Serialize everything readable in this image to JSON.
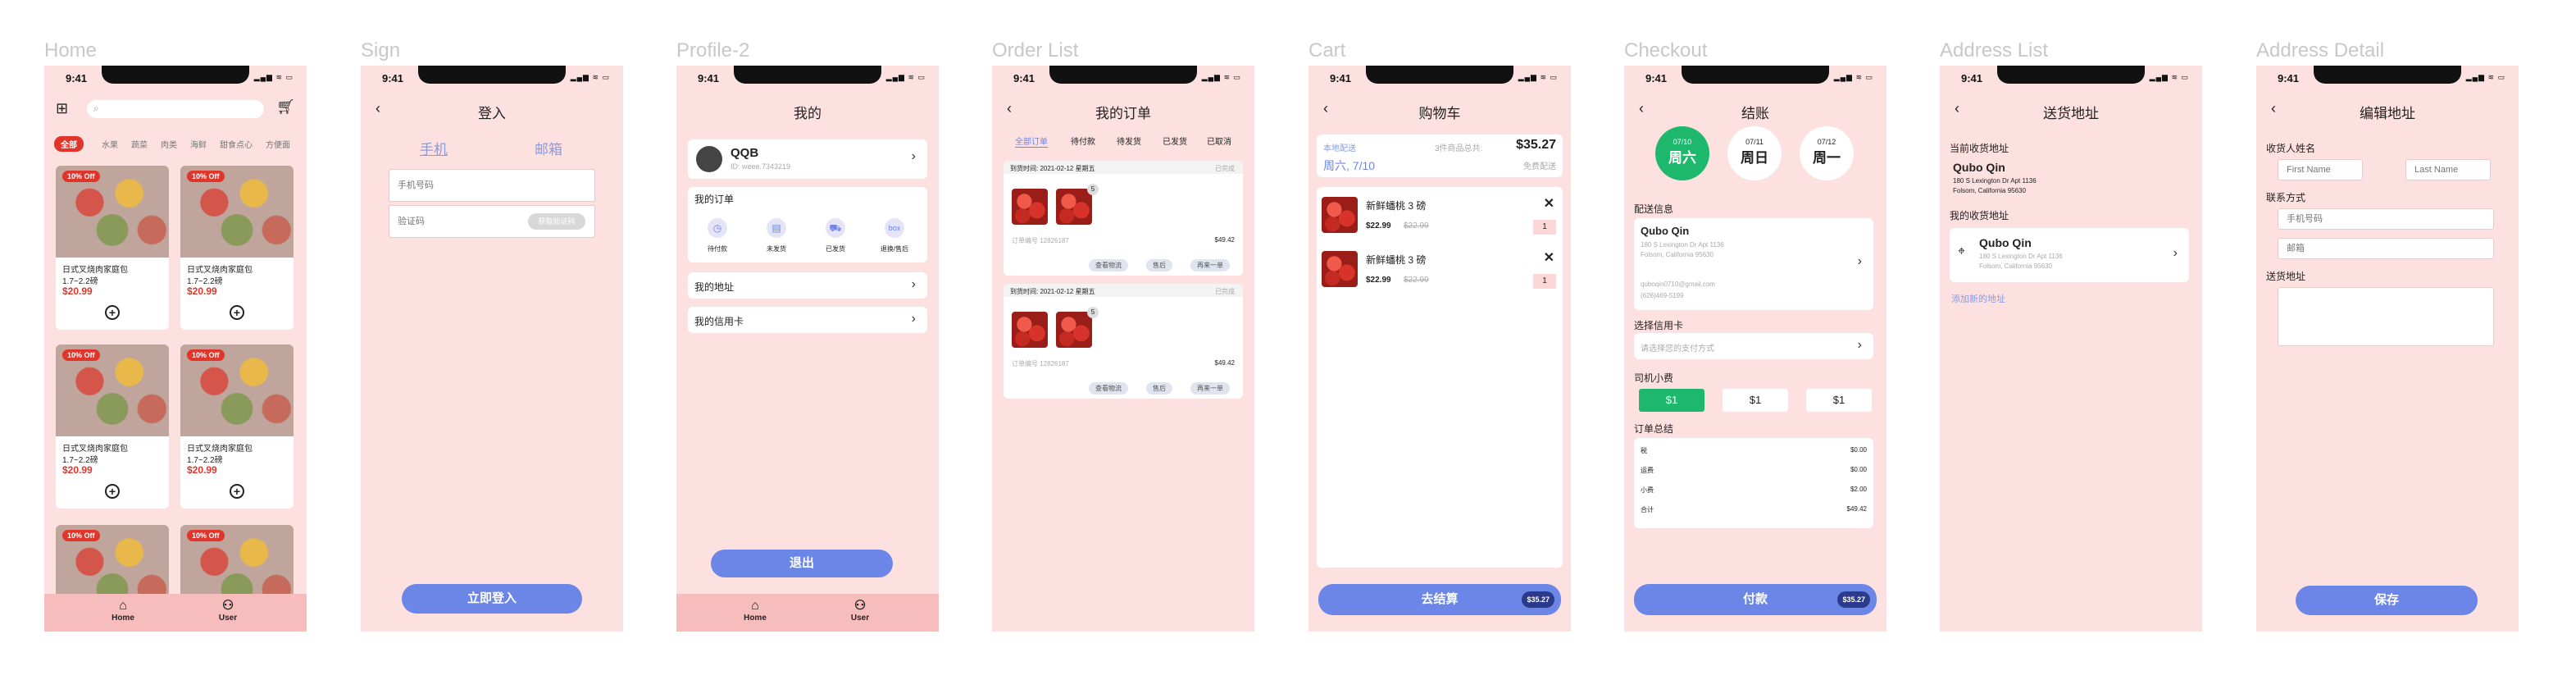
{
  "frames": {
    "home": "Home",
    "sign": "Sign",
    "profile": "Profile-2",
    "orders": "Order List",
    "cart": "Cart",
    "checkout": "Checkout",
    "address_list": "Address List",
    "address_detail": "Address Detail"
  },
  "status": {
    "time": "9:41",
    "icons": "▂▄▆ ≋ ▭"
  },
  "colors": {
    "background": "#fde0e0",
    "accent": "#6b86e6",
    "price": "#e0352b",
    "green": "#1db86b",
    "bottom_bar": "#f7bcbc"
  },
  "home": {
    "categories": [
      "全部",
      "水果",
      "蔬菜",
      "肉类",
      "海鲜",
      "甜食点心",
      "方便面"
    ],
    "discount": "10% Off",
    "product_name": "日式叉烧肉家庭包",
    "product_weight": "1.7~2.2磅",
    "product_price": "$20.99",
    "tab_home": "Home",
    "tab_user": "User"
  },
  "sign": {
    "title": "登入",
    "tab_phone": "手机",
    "tab_email": "邮箱",
    "phone_placeholder": "手机号码",
    "code_placeholder": "验证码",
    "send_code": "获取验证码",
    "login": "立即登入"
  },
  "profile": {
    "title": "我的",
    "user_name": "QQB",
    "user_id": "ID: weee.7343219",
    "my_orders": "我的订单",
    "order_states": [
      "待付款",
      "未发货",
      "已发货",
      "退换/售后"
    ],
    "my_address": "我的地址",
    "my_card": "我的信用卡",
    "logout": "退出",
    "tab_home": "Home",
    "tab_user": "User"
  },
  "orders": {
    "title": "我的订单",
    "tabs": [
      "全部订单",
      "待付款",
      "待发货",
      "已发货",
      "已取消"
    ],
    "order_time": "到货时间: 2021-02-12 星期五",
    "status": "已完成",
    "order_no": "订单编号 12826187",
    "count": "5",
    "amount": "$49.42",
    "actions": [
      "查看物流",
      "售后",
      "再来一单"
    ]
  },
  "cart": {
    "title": "购物车",
    "delivery_label": "本地配送",
    "total_label": "3件商品总共:",
    "total": "$35.27",
    "date": "周六, 7/10",
    "free_shipping": "免费配送",
    "item_name": "新鲜蟠桃 3 磅",
    "item_price": "$22.99",
    "item_old_price": "$22.99",
    "item_qty": "1",
    "checkout": "去结算",
    "checkout_total": "$35.27"
  },
  "checkout": {
    "title": "结账",
    "days": [
      {
        "date": "07/10",
        "day": "周六"
      },
      {
        "date": "07/11",
        "day": "周日"
      },
      {
        "date": "07/12",
        "day": "周一"
      }
    ],
    "shipping_info": "配送信息",
    "name": "Qubo Qin",
    "address_1": "180 S Lexington Dr Apt 1136",
    "address_2": "Folsom, California 95630",
    "email": "quboqin0710@gmail.com",
    "phone": "(626)469-5199",
    "choose_card": "选择信用卡",
    "card_placeholder": "请选择您的支付方式",
    "tip_label": "司机小费",
    "tips": [
      "$1",
      "$1",
      "$1"
    ],
    "summary_label": "订单总结",
    "summary": [
      {
        "label": "税",
        "value": "$0.00"
      },
      {
        "label": "运费",
        "value": "$0.00"
      },
      {
        "label": "小费",
        "value": "$2.00"
      },
      {
        "label": "合计",
        "value": "$49.42"
      }
    ],
    "pay": "付款",
    "pay_total": "$35.27"
  },
  "address_list": {
    "title": "送货地址",
    "current_label": "当前收货地址",
    "name": "Qubo Qin",
    "address_1": "180 S Lexington Dr Apt 1136",
    "address_2": "Folsom, California 95630",
    "my_addresses": "我的收货地址",
    "add_new": "添加新的地址"
  },
  "address_detail": {
    "title": "编辑地址",
    "recipient_label": "收货人姓名",
    "first_name": "First Name",
    "last_name": "Last Name",
    "contact_label": "联系方式",
    "phone_placeholder": "手机号码",
    "email_placeholder": "邮箱",
    "address_label": "送货地址",
    "save": "保存"
  }
}
